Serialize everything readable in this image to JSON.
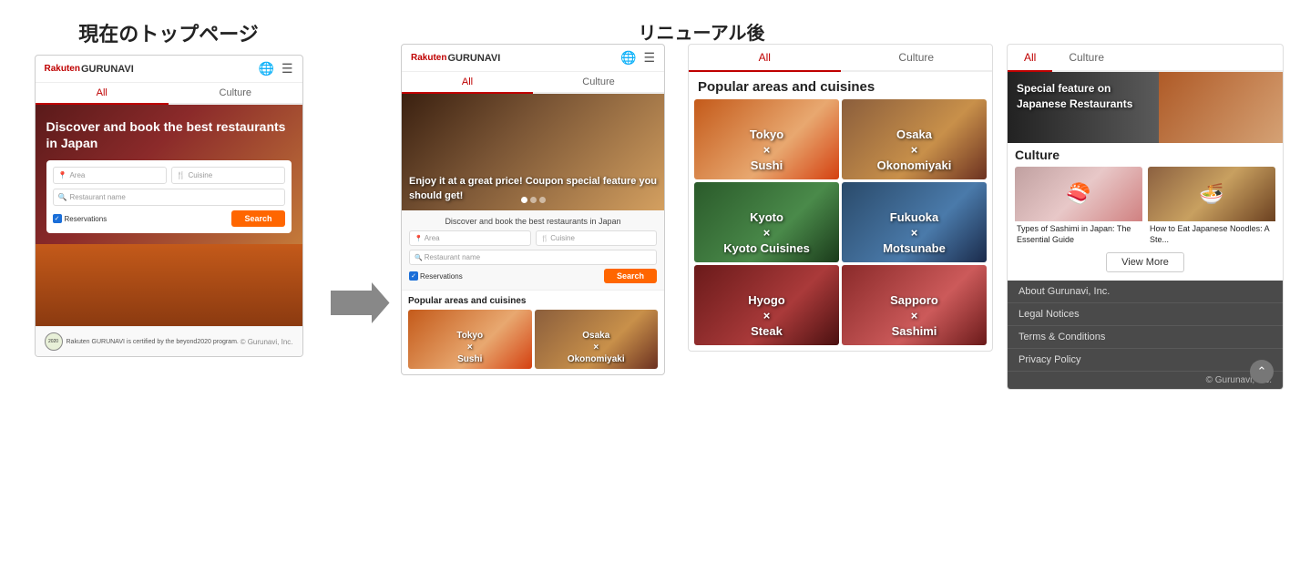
{
  "page": {
    "renewal_title": "リニューアル後",
    "current_label": "現在のトップページ"
  },
  "current_phone": {
    "logo_rakuten": "Rakuten",
    "logo_gurunavi": "GURUNAVI",
    "tabs": [
      "All",
      "Culture"
    ],
    "hero_text": "Discover and book the best restaurants in Japan",
    "search_area_placeholder": "Area",
    "search_cuisine_placeholder": "Cuisine",
    "search_restaurant_placeholder": "Restaurant name",
    "reservations_label": "Reservations",
    "search_button": "Search",
    "footer_cert": "Rakuten GURUNAVI is certified by the beyond2020 program.",
    "footer_copyright": "© Gurunavi, Inc."
  },
  "renewal_phone": {
    "logo_rakuten": "Rakuten",
    "logo_gurunavi": "GURUNAVI",
    "tabs": [
      "All",
      "Culture"
    ],
    "hero_text": "Enjoy it at a great price! Coupon special feature you should get!",
    "dots": [
      true,
      false,
      false
    ],
    "search_label": "Discover and book the best restaurants in Japan",
    "search_area_placeholder": "Area",
    "search_cuisine_placeholder": "Cuisine",
    "search_restaurant_placeholder": "Restaurant name",
    "reservations_label": "Reservations",
    "search_button": "Search",
    "popular_title": "Popular areas and cuisines",
    "areas": [
      {
        "name": "Tokyo",
        "sub": "×",
        "cuisine": "Sushi"
      },
      {
        "name": "Osaka",
        "sub": "×",
        "cuisine": "Okonomiyaki"
      }
    ]
  },
  "popular_panel": {
    "tabs": [
      "All",
      "Culture"
    ],
    "title": "Popular areas and cuisines",
    "areas": [
      {
        "name": "Tokyo",
        "sub": "×",
        "cuisine": "Sushi",
        "bg": "sushi"
      },
      {
        "name": "Osaka",
        "sub": "×",
        "cuisine": "Okonomiyaki",
        "bg": "okonomiyaki"
      },
      {
        "name": "Kyoto",
        "sub": "×",
        "cuisine": "Kyoto Cuisines",
        "bg": "kyoto"
      },
      {
        "name": "Fukuoka",
        "sub": "×",
        "cuisine": "Motsunabe",
        "bg": "fukuoka"
      },
      {
        "name": "Hyogo",
        "sub": "×",
        "cuisine": "Steak",
        "bg": "hyogo"
      },
      {
        "name": "Sapporo",
        "sub": "×",
        "cuisine": "Sashimi",
        "bg": "sapporo"
      }
    ]
  },
  "right_panel": {
    "tabs": [
      "All",
      "Culture"
    ],
    "feature_text": "Special feature on Japanese Restaurants",
    "culture_title": "Culture",
    "articles": [
      {
        "title": "Types of Sashimi in Japan: The Essential Guide"
      },
      {
        "title": "How to Eat Japanese Noodles: A Ste..."
      }
    ],
    "view_more": "View More",
    "footer_links": [
      "About Gurunavi, Inc.",
      "Legal Notices",
      "Terms & Conditions",
      "Privacy Policy"
    ],
    "copyright": "© Gurunavi, Inc."
  }
}
